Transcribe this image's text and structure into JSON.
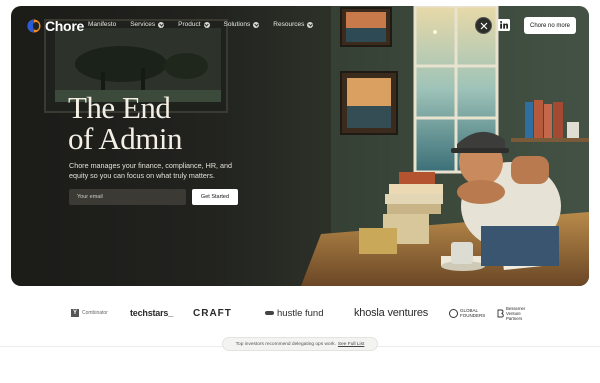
{
  "brand": {
    "name": "Chore"
  },
  "nav": {
    "links": [
      {
        "label": "Manifesto",
        "has_dropdown": false
      },
      {
        "label": "Services",
        "has_dropdown": true
      },
      {
        "label": "Product",
        "has_dropdown": true
      },
      {
        "label": "Solutions",
        "has_dropdown": true
      },
      {
        "label": "Resources",
        "has_dropdown": true
      }
    ],
    "social": [
      {
        "icon": "x-logo-icon"
      },
      {
        "icon": "linkedin-icon"
      }
    ],
    "cta_label": "Chore no more"
  },
  "hero": {
    "headline_line1": "The End",
    "headline_line2": "of Admin",
    "subtitle": "Chore manages your finance, compliance, HR, and equity so you can focus on what truly matters.",
    "email_placeholder": "Your email",
    "button_label": "Get Started"
  },
  "investors": {
    "yc": "Combinator",
    "techstars": "techstars_",
    "craft": "CRAFT",
    "hustle": "hustle fund",
    "khosla": "khosla ventures",
    "global_founders": "GLOBAL FOUNDERS",
    "bessemer": "Bessemer Venture Partners"
  },
  "footer_pill": {
    "text": "Top investors recommend delegating ops work.",
    "link": "See Full List"
  },
  "colors": {
    "hero_bg": "#22231f",
    "accent_white": "#ffffff",
    "logo_orange": "#f28b1e",
    "logo_blue": "#2a5bd7"
  }
}
